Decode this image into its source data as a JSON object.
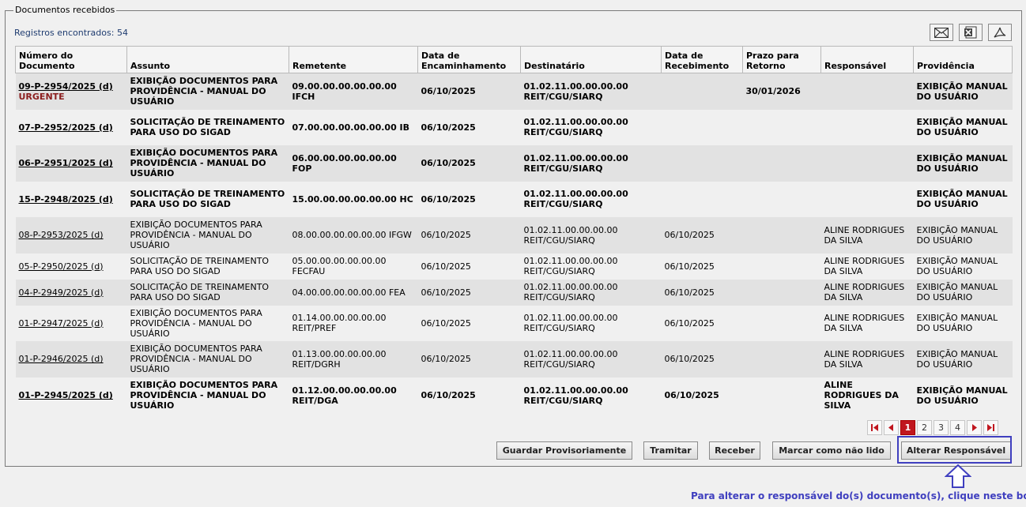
{
  "fieldset": {
    "legend": "Documentos recebidos"
  },
  "records": {
    "label": "Registros encontrados: 54"
  },
  "export_icons": [
    "email-icon",
    "excel-icon",
    "pdf-icon"
  ],
  "table": {
    "headers": [
      "Número do Documento",
      "Assunto",
      "Remetente",
      "Data de Encaminhamento",
      "Destinatário",
      "Data de Recebimento",
      "Prazo para Retorno",
      "Responsável",
      "Providência"
    ],
    "rows": [
      {
        "bold": true,
        "doc": "09-P-2954/2025 (d)",
        "flag": "URGENTE",
        "assunto": "EXIBIÇÃO DOCUMENTOS PARA PROVIDÊNCIA - MANUAL DO USUÁRIO",
        "remetente": "09.00.00.00.00.00.00 IFCH",
        "encaminhamento": "06/10/2025",
        "destinatario": "01.02.11.00.00.00.00 REIT/CGU/SIARQ",
        "recebimento": "",
        "prazo": "30/01/2026",
        "responsavel": "",
        "providencia": "EXIBIÇÃO MANUAL DO USUÁRIO"
      },
      {
        "bold": true,
        "doc": "07-P-2952/2025 (d)",
        "flag": "",
        "assunto": "SOLICITAÇÃO DE TREINAMENTO PARA USO DO SIGAD",
        "remetente": "07.00.00.00.00.00.00 IB",
        "encaminhamento": "06/10/2025",
        "destinatario": "01.02.11.00.00.00.00 REIT/CGU/SIARQ",
        "recebimento": "",
        "prazo": "",
        "responsavel": "",
        "providencia": "EXIBIÇÃO MANUAL DO USUÁRIO"
      },
      {
        "bold": true,
        "doc": "06-P-2951/2025 (d)",
        "flag": "",
        "assunto": "EXIBIÇÃO DOCUMENTOS PARA PROVIDÊNCIA - MANUAL DO USUÁRIO",
        "remetente": "06.00.00.00.00.00.00 FOP",
        "encaminhamento": "06/10/2025",
        "destinatario": "01.02.11.00.00.00.00 REIT/CGU/SIARQ",
        "recebimento": "",
        "prazo": "",
        "responsavel": "",
        "providencia": "EXIBIÇÃO MANUAL DO USUÁRIO"
      },
      {
        "bold": true,
        "doc": "15-P-2948/2025 (d)",
        "flag": "",
        "assunto": "SOLICITAÇÃO DE TREINAMENTO PARA USO DO SIGAD",
        "remetente": "15.00.00.00.00.00.00 HC",
        "encaminhamento": "06/10/2025",
        "destinatario": "01.02.11.00.00.00.00 REIT/CGU/SIARQ",
        "recebimento": "",
        "prazo": "",
        "responsavel": "",
        "providencia": "EXIBIÇÃO MANUAL DO USUÁRIO"
      },
      {
        "bold": false,
        "doc": "08-P-2953/2025 (d)",
        "flag": "",
        "assunto": "EXIBIÇÃO DOCUMENTOS PARA PROVIDÊNCIA - MANUAL DO USUÁRIO",
        "remetente": "08.00.00.00.00.00.00 IFGW",
        "encaminhamento": "06/10/2025",
        "destinatario": "01.02.11.00.00.00.00 REIT/CGU/SIARQ",
        "recebimento": "06/10/2025",
        "prazo": "",
        "responsavel": "ALINE RODRIGUES DA SILVA",
        "providencia": "EXIBIÇÃO MANUAL DO USUÁRIO"
      },
      {
        "bold": false,
        "doc": "05-P-2950/2025 (d)",
        "flag": "",
        "assunto": "SOLICITAÇÃO DE TREINAMENTO PARA USO DO SIGAD",
        "remetente": "05.00.00.00.00.00.00 FECFAU",
        "encaminhamento": "06/10/2025",
        "destinatario": "01.02.11.00.00.00.00 REIT/CGU/SIARQ",
        "recebimento": "06/10/2025",
        "prazo": "",
        "responsavel": "ALINE RODRIGUES DA SILVA",
        "providencia": "EXIBIÇÃO MANUAL DO USUÁRIO"
      },
      {
        "bold": false,
        "doc": "04-P-2949/2025 (d)",
        "flag": "",
        "assunto": "SOLICITAÇÃO DE TREINAMENTO PARA USO DO SIGAD",
        "remetente": "04.00.00.00.00.00.00 FEA",
        "encaminhamento": "06/10/2025",
        "destinatario": "01.02.11.00.00.00.00 REIT/CGU/SIARQ",
        "recebimento": "06/10/2025",
        "prazo": "",
        "responsavel": "ALINE RODRIGUES DA SILVA",
        "providencia": "EXIBIÇÃO MANUAL DO USUÁRIO"
      },
      {
        "bold": false,
        "doc": "01-P-2947/2025 (d)",
        "flag": "",
        "assunto": "EXIBIÇÃO DOCUMENTOS PARA PROVIDÊNCIA - MANUAL DO USUÁRIO",
        "remetente": "01.14.00.00.00.00.00 REIT/PREF",
        "encaminhamento": "06/10/2025",
        "destinatario": "01.02.11.00.00.00.00 REIT/CGU/SIARQ",
        "recebimento": "06/10/2025",
        "prazo": "",
        "responsavel": "ALINE RODRIGUES DA SILVA",
        "providencia": "EXIBIÇÃO MANUAL DO USUÁRIO"
      },
      {
        "bold": false,
        "doc": "01-P-2946/2025 (d)",
        "flag": "",
        "assunto": "EXIBIÇÃO DOCUMENTOS PARA PROVIDÊNCIA - MANUAL DO USUÁRIO",
        "remetente": "01.13.00.00.00.00.00 REIT/DGRH",
        "encaminhamento": "06/10/2025",
        "destinatario": "01.02.11.00.00.00.00 REIT/CGU/SIARQ",
        "recebimento": "06/10/2025",
        "prazo": "",
        "responsavel": "ALINE RODRIGUES DA SILVA",
        "providencia": "EXIBIÇÃO MANUAL DO USUÁRIO"
      },
      {
        "bold": true,
        "doc": "01-P-2945/2025 (d)",
        "flag": "",
        "assunto": "EXIBIÇÃO DOCUMENTOS PARA PROVIDÊNCIA - MANUAL DO USUÁRIO",
        "remetente": "01.12.00.00.00.00.00 REIT/DGA",
        "encaminhamento": "06/10/2025",
        "destinatario": "01.02.11.00.00.00.00 REIT/CGU/SIARQ",
        "recebimento": "06/10/2025",
        "prazo": "",
        "responsavel": "ALINE RODRIGUES DA SILVA",
        "providencia": "EXIBIÇÃO MANUAL DO USUÁRIO"
      }
    ]
  },
  "pagination": {
    "pages": [
      "1",
      "2",
      "3",
      "4"
    ],
    "current": "1",
    "icons": [
      "first-page-icon",
      "prev-page-icon",
      "next-page-icon",
      "last-page-icon"
    ]
  },
  "actions": {
    "save_draft": "Guardar Provisoriamente",
    "forward": "Tramitar",
    "receive": "Receber",
    "mark_unread": "Marcar como não lido",
    "change_owner": "Alterar Responsável"
  },
  "hint": {
    "text": "Para alterar o responsável do(s) documento(s), clique neste botão"
  },
  "colors": {
    "accent": "#3f3fbf",
    "urgent": "#8b1e1e",
    "pager_active": "#c0161e"
  }
}
